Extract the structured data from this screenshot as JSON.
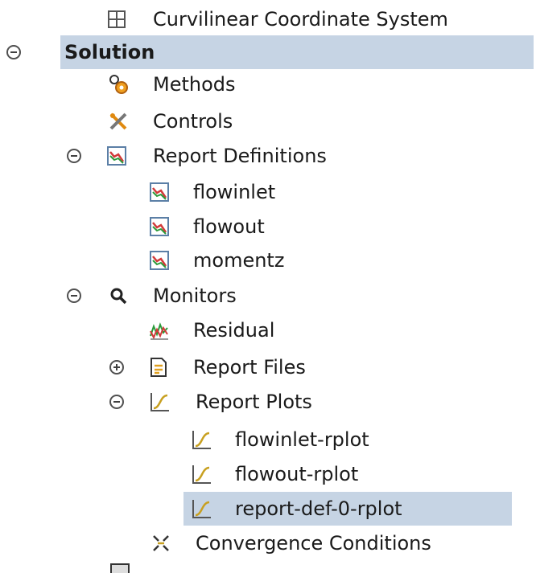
{
  "tree": {
    "curvilinear": "Curvilinear Coordinate System",
    "solution": "Solution",
    "methods": "Methods",
    "controls": "Controls",
    "report_definitions": "Report Definitions",
    "report_defs": [
      "flowinlet",
      "flowout",
      "momentz"
    ],
    "monitors": "Monitors",
    "residual": "Residual",
    "report_files": "Report Files",
    "report_plots": "Report Plots",
    "plots": [
      "flowinlet-rplot",
      "flowout-rplot",
      "report-def-0-rplot"
    ],
    "convergence": "Convergence Conditions"
  },
  "colors": {
    "selection": "#c6d4e4",
    "report_def_icon": "#d23a3a",
    "plot_icon": "#c8a020"
  }
}
